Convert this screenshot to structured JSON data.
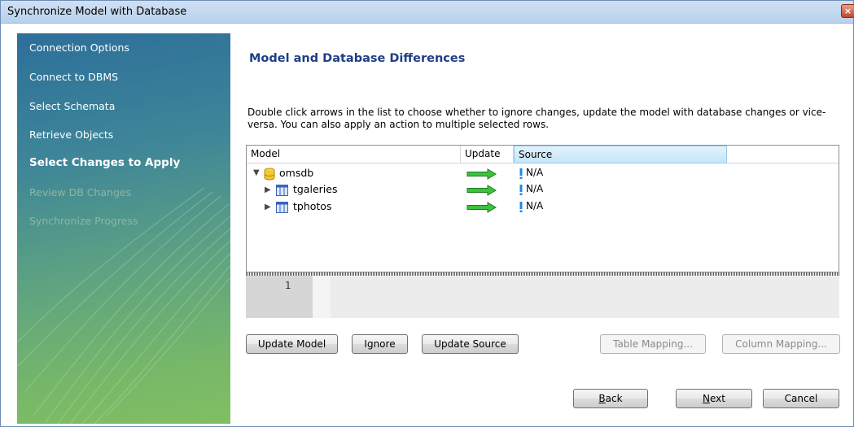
{
  "window": {
    "title": "Synchronize Model with Database",
    "close_glyph": "×"
  },
  "sidebar": {
    "steps": [
      {
        "label": "Connection Options",
        "state": "done"
      },
      {
        "label": "Connect to DBMS",
        "state": "done"
      },
      {
        "label": "Select Schemata",
        "state": "done"
      },
      {
        "label": "Retrieve Objects",
        "state": "done"
      },
      {
        "label": "Select Changes to Apply",
        "state": "current"
      },
      {
        "label": "Review DB Changes",
        "state": "future"
      },
      {
        "label": "Synchronize Progress",
        "state": "future"
      }
    ]
  },
  "main": {
    "heading": "Model and Database Differences",
    "description": "Double click arrows in the list to choose whether to ignore changes, update the model with database changes or vice-versa. You can also apply an action to multiple selected rows."
  },
  "grid": {
    "columns": [
      "Model",
      "Update",
      "Source"
    ],
    "rows": [
      {
        "name": "omsdb",
        "icon": "database-icon",
        "expanded": true,
        "update_icon": "arrow-right-icon",
        "source": "N/A"
      },
      {
        "name": "tgaleries",
        "icon": "table-icon",
        "expanded": false,
        "update_icon": "arrow-right-icon",
        "source": "N/A"
      },
      {
        "name": "tphotos",
        "icon": "table-icon",
        "expanded": false,
        "update_icon": "arrow-right-icon",
        "source": "N/A"
      }
    ]
  },
  "editor": {
    "line_number": "1"
  },
  "actions": {
    "update_model": "Update Model",
    "ignore": "Ignore",
    "update_source": "Update Source",
    "table_mapping": "Table Mapping...",
    "column_mapping": "Column Mapping..."
  },
  "nav": {
    "back_mnemonic": "B",
    "back_rest": "ack",
    "next_mnemonic": "N",
    "next_rest": "ext",
    "cancel": "Cancel"
  },
  "colors": {
    "heading": "#1f3e88",
    "arrow_fill": "#3cc23c",
    "arrow_stroke": "#1c7d1c",
    "source_marker": "#1e88e5"
  }
}
